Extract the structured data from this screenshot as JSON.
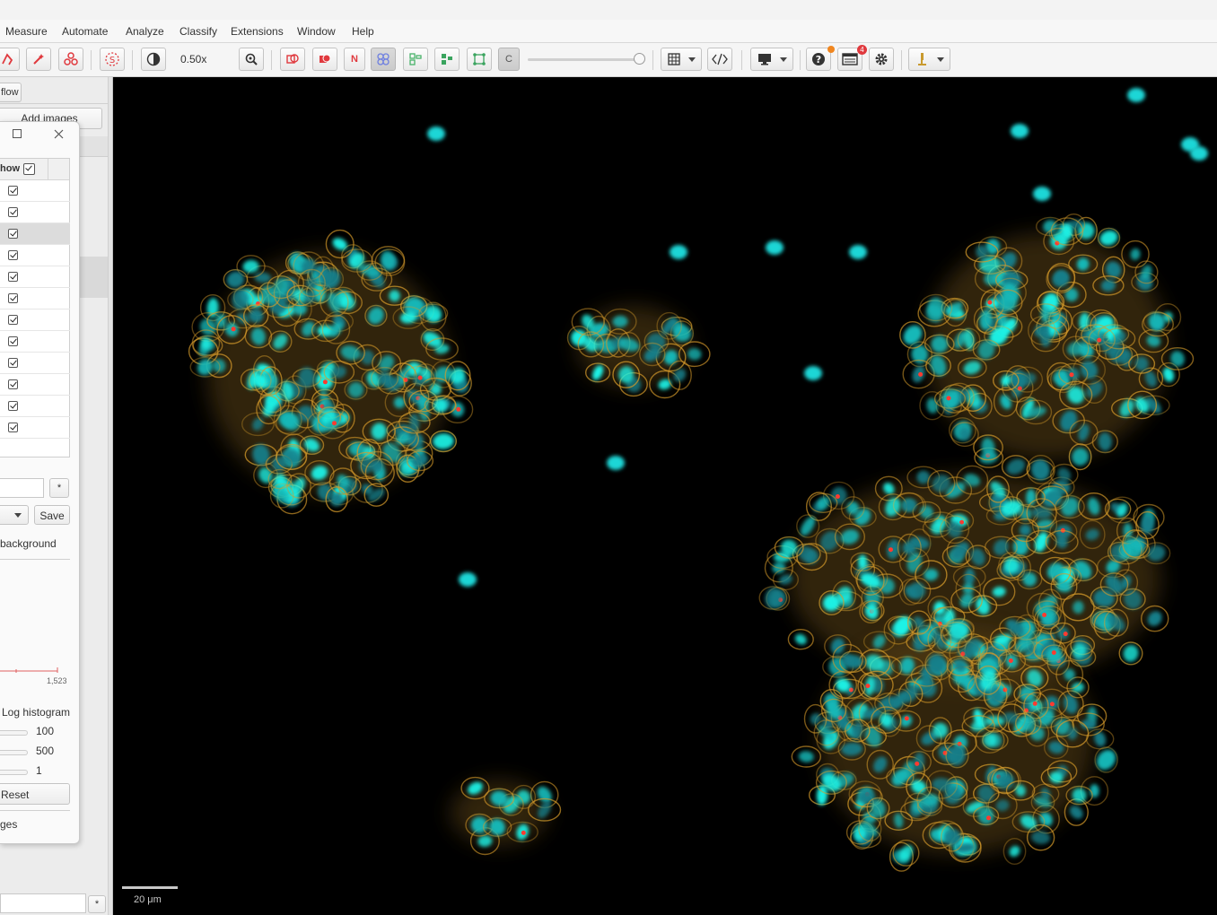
{
  "menu": [
    "Measure",
    "Automate",
    "Analyze",
    "Classify",
    "Extensions",
    "Window",
    "Help"
  ],
  "toolbar": {
    "zoom": "0.50x",
    "label_n": "N",
    "label_c": "C",
    "notification_count": "4"
  },
  "left_panel": {
    "tab_label": "flow",
    "add_images_label": "Add images"
  },
  "dialog": {
    "column_header": "how",
    "row_checked": [
      true,
      true,
      true,
      true,
      true,
      true,
      true,
      true,
      true,
      true,
      true,
      true
    ],
    "filter_btn": "*",
    "save_label": "Save",
    "background_label": "background",
    "hist_max": "1,523",
    "log_hist_label": "Log histogram",
    "values": [
      "100",
      "500",
      "1"
    ],
    "reset_label": "Reset",
    "ges_label": "ges"
  },
  "bottom": {
    "filter_btn": "*"
  },
  "viewer": {
    "scalebar_label": "20 μm"
  }
}
